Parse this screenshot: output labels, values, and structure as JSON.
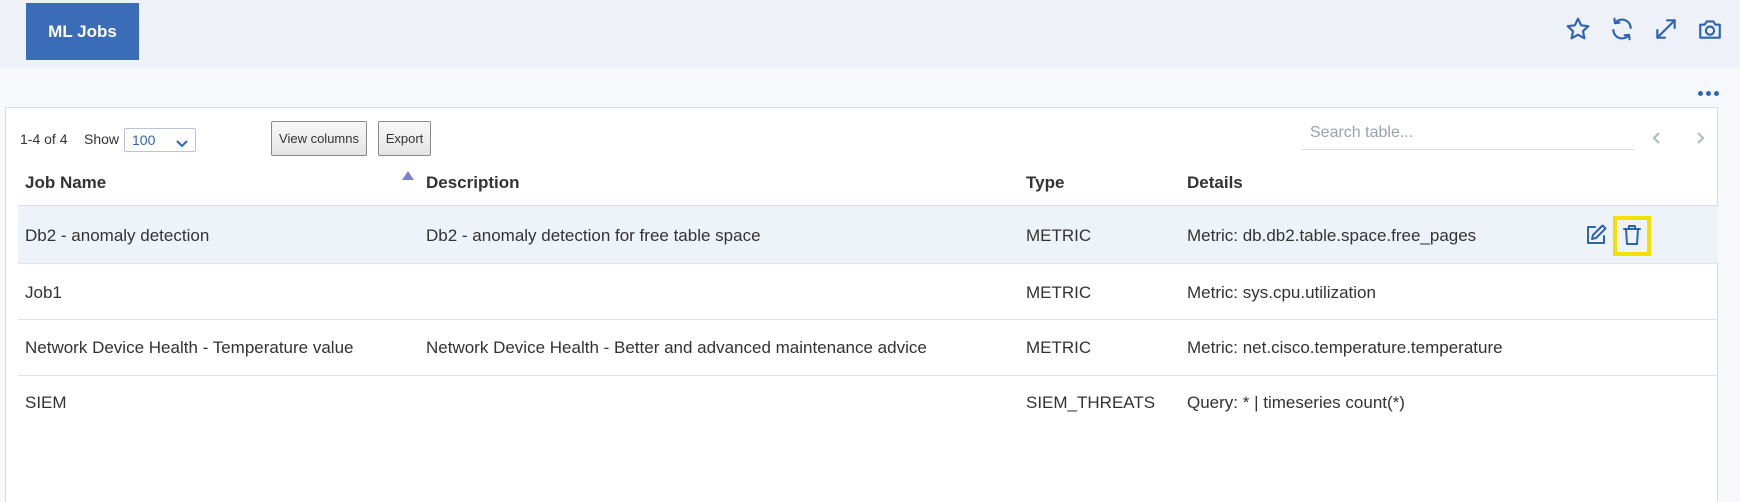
{
  "header": {
    "title": "ML Jobs",
    "icons": [
      "star-icon",
      "refresh-icon",
      "expand-icon",
      "camera-icon"
    ]
  },
  "toolbar": {
    "count_text": "1-4 of 4",
    "show_label": "Show",
    "show_value": "100",
    "view_columns_label": "View columns",
    "export_label": "Export",
    "search_placeholder": "Search table..."
  },
  "table": {
    "columns": [
      "Job Name",
      "Description",
      "Type",
      "Details"
    ],
    "sorted_column": "Job Name",
    "rows": [
      {
        "name": "Db2 - anomaly detection",
        "description": "Db2 - anomaly detection for free table space",
        "type": "METRIC",
        "details": "Metric: db.db2.table.space.free_pages"
      },
      {
        "name": "Job1",
        "description": "",
        "type": "METRIC",
        "details": "Metric: sys.cpu.utilization"
      },
      {
        "name": "Network Device Health - Temperature value",
        "description": "Network Device Health - Better and advanced maintenance advice",
        "type": "METRIC",
        "details": "Metric: net.cisco.temperature.temperature"
      },
      {
        "name": "SIEM",
        "description": "",
        "type": "SIEM_THREATS",
        "details": "Query: * | timeseries count(*)"
      }
    ]
  },
  "colors": {
    "accent": "#3b6cb8",
    "icon_blue": "#2e64b4",
    "highlight": "#f5e100"
  }
}
